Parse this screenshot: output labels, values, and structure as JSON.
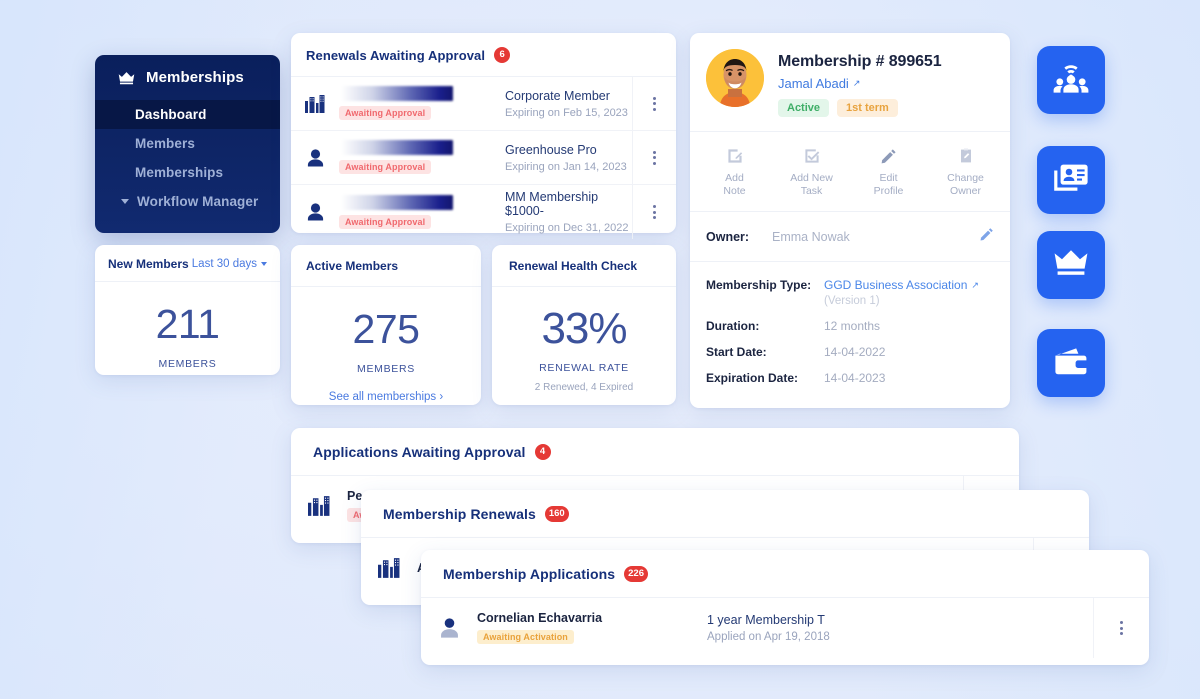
{
  "sidebar": {
    "brand": "Memberships",
    "brand_icon": "crown-icon",
    "items": [
      {
        "label": "Dashboard",
        "active": true
      },
      {
        "label": "Members",
        "active": false
      },
      {
        "label": "Memberships",
        "active": false
      }
    ],
    "workflow": {
      "label": "Workflow Manager",
      "icon": "chevron-down-icon"
    }
  },
  "renewals": {
    "title": "Renewals Awaiting Approval",
    "count": "6",
    "rows": [
      {
        "icon": "building-icon",
        "status": "Awaiting Approval",
        "name_redacted": true,
        "plan": "Corporate Member",
        "meta": "Expiring on Feb 15, 2023"
      },
      {
        "icon": "person-icon",
        "status": "Awaiting Approval",
        "name_redacted": true,
        "plan": "Greenhouse Pro",
        "meta": "Expiring on Jan 14, 2023"
      },
      {
        "icon": "person-icon",
        "status": "Awaiting Approval",
        "name_redacted": true,
        "plan": "MM Membership $1000-",
        "meta": "Expiring on Dec 31, 2022"
      }
    ]
  },
  "new_members": {
    "title": "New Members",
    "range": "Last 30 days",
    "value": "211",
    "unit": "MEMBERS"
  },
  "active_members": {
    "title": "Active Members",
    "value": "275",
    "unit": "MEMBERS",
    "link": "See all memberships  ›"
  },
  "renewal_health": {
    "title": "Renewal Health Check",
    "value": "33%",
    "unit": "RENEWAL RATE",
    "sub": "2 Renewed, 4 Expired"
  },
  "detail": {
    "heading": "Membership # 899651",
    "member_link": "Jamal Abadi",
    "status_pill": "Active",
    "term_pill": "1st term",
    "actions": [
      {
        "label": "Add\nNote",
        "l1": "Add",
        "l2": "Note",
        "icon": "note-edit-icon"
      },
      {
        "label": "Add New Task",
        "l1": "Add New",
        "l2": "Task",
        "icon": "checkbox-check-icon"
      },
      {
        "label": "Edit Profile",
        "l1": "Edit",
        "l2": "Profile",
        "icon": "pencil-icon"
      },
      {
        "label": "Change Owner",
        "l1": "Change",
        "l2": "Owner",
        "icon": "clipboard-pencil-icon"
      }
    ],
    "owner_label": "Owner:",
    "owner_value": "Emma Nowak",
    "owner_edit_icon": "pencil-icon",
    "fields": [
      {
        "label": "Membership Type:",
        "value": "GGD Business Association",
        "link": true,
        "sub": "(Version 1)"
      },
      {
        "label": "Duration:",
        "value": "12 months",
        "link": false,
        "sub": ""
      },
      {
        "label": "Start Date:",
        "value": "14-04-2022",
        "link": false,
        "sub": ""
      },
      {
        "label": "Expiration Date:",
        "value": "14-04-2023",
        "link": false,
        "sub": ""
      }
    ]
  },
  "quick_buttons": [
    {
      "icon": "community-wifi-icon",
      "name": "community-button"
    },
    {
      "icon": "id-card-icon",
      "name": "id-card-button"
    },
    {
      "icon": "crown-icon",
      "name": "memberships-button"
    },
    {
      "icon": "wallet-icon",
      "name": "wallet-button"
    }
  ],
  "stack": {
    "applications_awaiting": {
      "title": "Applications Awaiting Approval",
      "count": "4",
      "row": {
        "icon": "building-icon",
        "name": "Pes",
        "status": "Aw"
      }
    },
    "membership_renewals": {
      "title": "Membership Renewals",
      "count": "160",
      "row": {
        "icon": "building-icon",
        "name": "A"
      }
    },
    "membership_applications": {
      "title": "Membership Applications",
      "count": "226",
      "row": {
        "icon": "person-icon",
        "name": "Cornelian Echavarria",
        "status": "Awaiting Activation",
        "plan": "1 year Membership T",
        "meta": "Applied on Apr 19, 2018"
      }
    }
  },
  "colors": {
    "background": "#dde7fb",
    "brand_blue": "#2563f0",
    "navy": "#0a1f5c",
    "link": "#4a7ae0",
    "badge_red": "#e53935",
    "pill_green": "#3fae67",
    "pill_orange": "#e8a33f",
    "await_red": "#f0696e",
    "stat_number": "#3c529b"
  }
}
